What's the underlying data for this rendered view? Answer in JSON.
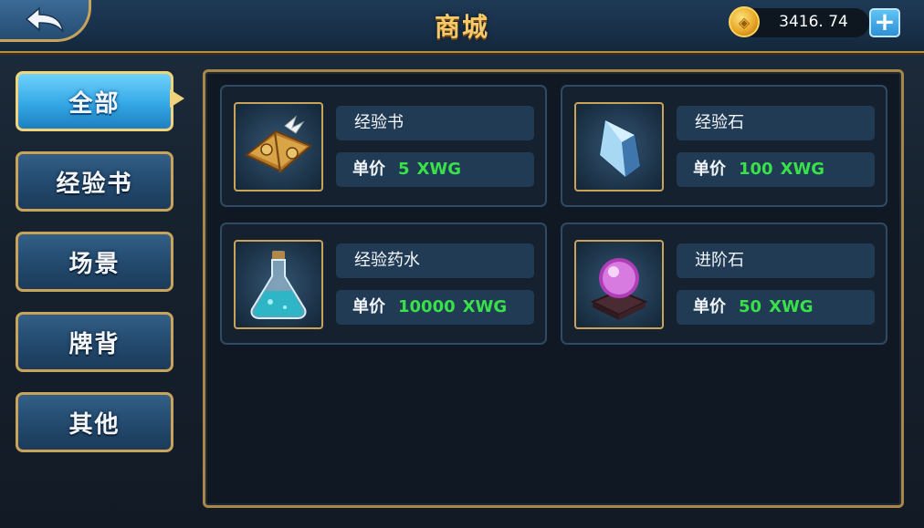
{
  "header": {
    "title": "商城",
    "back_icon": "back-arrow-icon",
    "coin_icon": "gold-coin-icon",
    "coin_amount": "3416. 74",
    "add_icon": "plus-icon"
  },
  "tabs": [
    {
      "label": "全部",
      "active": true
    },
    {
      "label": "经验书",
      "active": false
    },
    {
      "label": "场景",
      "active": false
    },
    {
      "label": "牌背",
      "active": false
    },
    {
      "label": "其他",
      "active": false
    }
  ],
  "items": [
    {
      "name": "经验书",
      "price_label": "单价",
      "price": "5",
      "unit": "XWG",
      "icon": "experience-book-icon"
    },
    {
      "name": "经验石",
      "price_label": "单价",
      "price": "100",
      "unit": "XWG",
      "icon": "experience-stone-icon"
    },
    {
      "name": "经验药水",
      "price_label": "单价",
      "price": "10000",
      "unit": "XWG",
      "icon": "experience-potion-icon"
    },
    {
      "name": "进阶石",
      "price_label": "单价",
      "price": "50",
      "unit": "XWG",
      "icon": "advancement-stone-icon"
    }
  ],
  "colors": {
    "accent_gold": "#c9a35a",
    "price_green": "#38e04a",
    "active_tab": "#34a8e6"
  }
}
